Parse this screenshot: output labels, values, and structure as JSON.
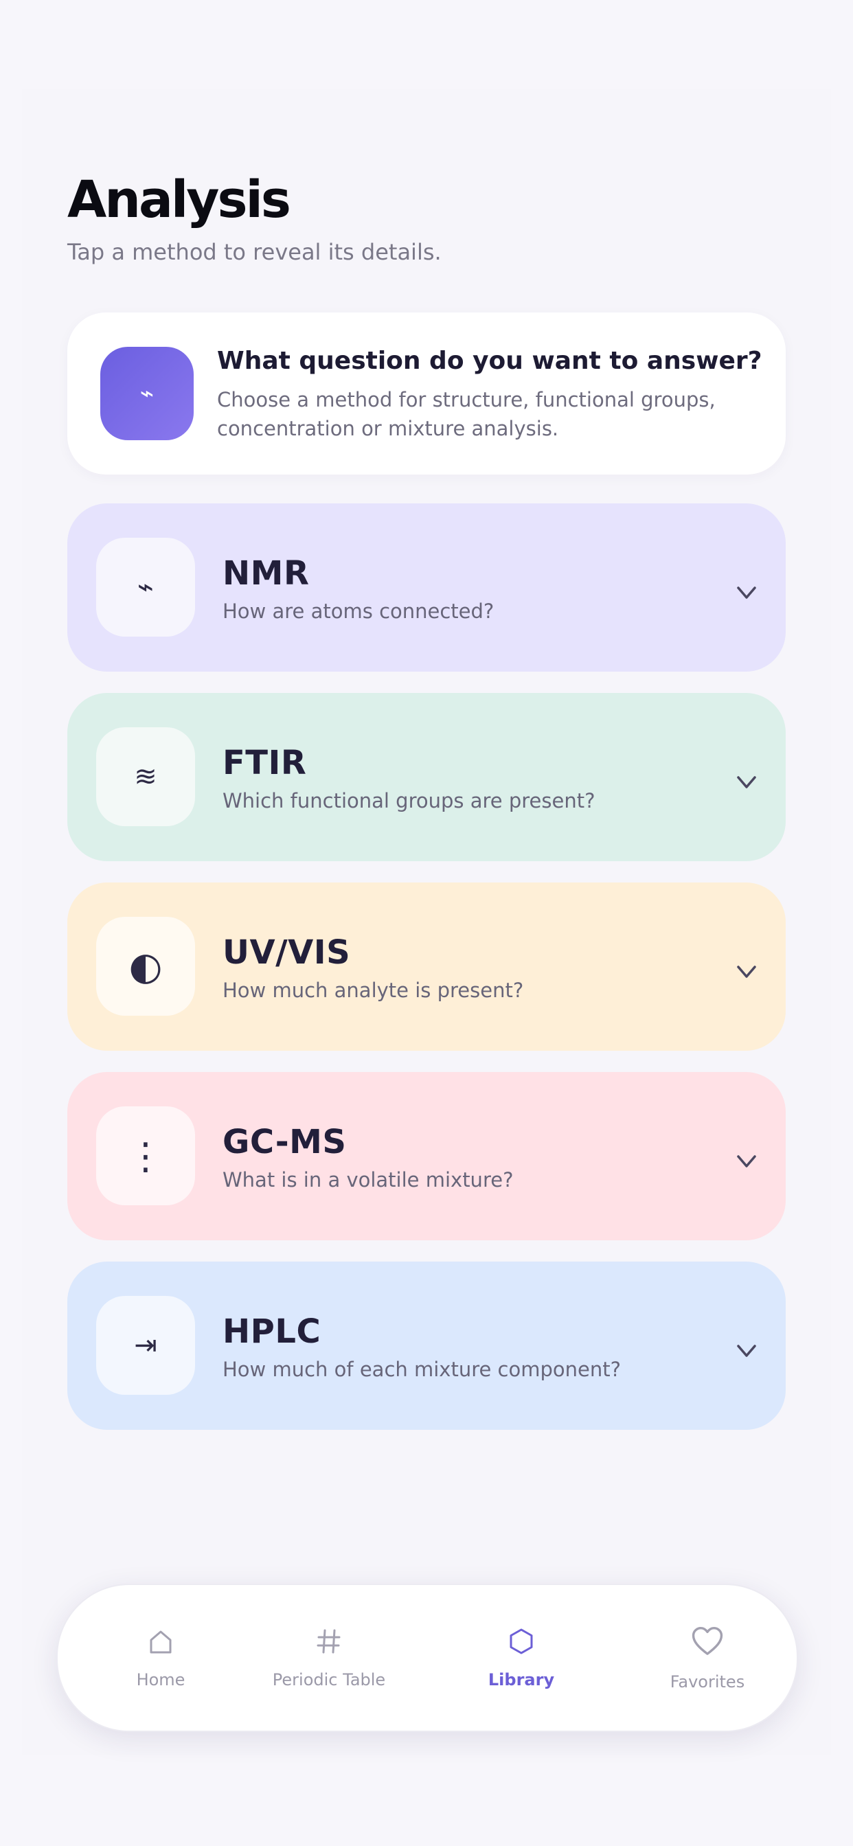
{
  "header": {
    "title": "Analysis",
    "subtitle": "Tap a method to reveal its details."
  },
  "intro": {
    "icon": "lightning-icon",
    "icon_glyph": "⌁",
    "title": "What question do you want to answer?",
    "text": "Choose a method for structure, functional groups, concentration or mixture analysis."
  },
  "methods": [
    {
      "name": "NMR",
      "question": "How are atoms connected?",
      "icon": "lightning-icon",
      "glyph": "⌁",
      "bg": "#e6e3fd",
      "icon_bg": "#f6f5fd"
    },
    {
      "name": "FTIR",
      "question": "Which functional groups are present?",
      "icon": "wave-icon",
      "glyph": "≋",
      "bg": "#dcf0ea",
      "icon_bg": "#f3f9f7"
    },
    {
      "name": "UV/VIS",
      "question": "How much analyte is present?",
      "icon": "half-circle-icon",
      "glyph": "◐",
      "bg": "#feefd7",
      "icon_bg": "#fffaf2"
    },
    {
      "name": "GC-MS",
      "question": "What is in a volatile mixture?",
      "icon": "dots-vertical-icon",
      "glyph": "⋮",
      "bg": "#ffe1e6",
      "icon_bg": "#fff5f7"
    },
    {
      "name": "HPLC",
      "question": "How much of each mixture component?",
      "icon": "arrow-to-bar-icon",
      "glyph": "⇥",
      "bg": "#dbe8fd",
      "icon_bg": "#f3f7fe"
    }
  ],
  "nav": {
    "items": [
      {
        "label": "Home",
        "icon": "home-icon",
        "active": false
      },
      {
        "label": "Periodic Table",
        "icon": "hash-icon",
        "active": false
      },
      {
        "label": "Library",
        "icon": "hexagon-icon",
        "active": true
      },
      {
        "label": "Favorites",
        "icon": "heart-icon",
        "active": false
      }
    ]
  },
  "colors": {
    "accent": "#6c5fd6",
    "background": "#f7f6fb",
    "text_dark": "#221f3a",
    "text_muted": "#676579"
  }
}
